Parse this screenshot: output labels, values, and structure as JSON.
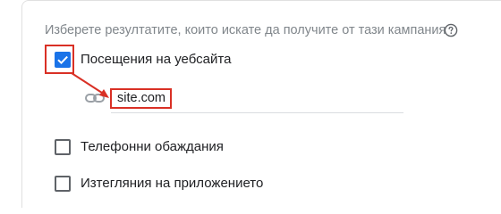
{
  "form": {
    "instruction": "Изберете резултатите, които искате да получите от тази кампания",
    "help_icon": "help-circle-icon",
    "options": [
      {
        "label": "Посещения на уебсайта",
        "checked": true
      },
      {
        "label": "Телефонни обаждания",
        "checked": false
      },
      {
        "label": "Изтегляния на приложението",
        "checked": false
      }
    ],
    "website": {
      "link_icon": "link-icon",
      "value": "site.com"
    }
  },
  "colors": {
    "accent": "#1a73e8",
    "annotation": "#d93025",
    "muted_text": "#80868b"
  }
}
